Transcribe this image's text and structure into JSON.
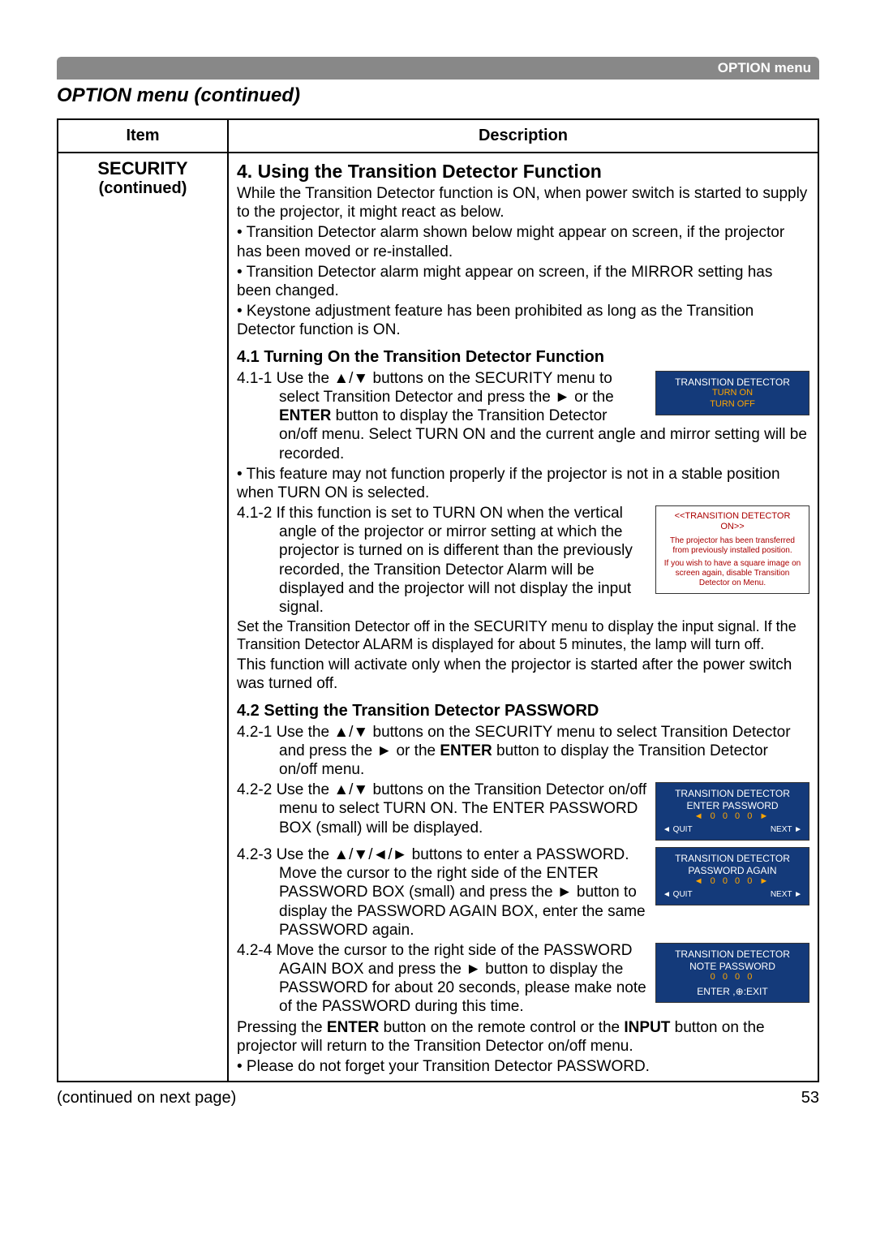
{
  "topbar": "OPTION menu",
  "section_title": "OPTION menu (continued)",
  "table": {
    "header_item": "Item",
    "header_desc": "Description",
    "item_label": "SECURITY",
    "item_sub": "(continued)"
  },
  "desc": {
    "h3": "4. Using the Transition Detector Function",
    "p1": "While the Transition Detector function is ON, when power switch is started to supply to the projector, it might react as below.",
    "b1": "• Transition Detector alarm shown below might appear on screen, if the projector has been moved or re-installed.",
    "b2": "• Transition Detector alarm might appear on screen, if the MIRROR setting has been changed.",
    "b3": "• Keystone adjustment feature has been prohibited as long as the Transition Detector function is ON.",
    "h4a": "4.1 Turning On the Transition Detector Function",
    "s411a": "4.1-1 Use the ▲/▼ buttons on the SECURITY menu to select Transition Detector and press the ► or the ",
    "s411b": "ENTER",
    "s411c": " button to display the Transition Detector on/off menu. Select TURN ON and the current angle and mirror setting will be recorded.",
    "s411note": "• This feature may not function properly if the projector is not in a stable position when TURN ON is selected.",
    "s412": "4.1-2 If this function is set to TURN ON when the vertical angle of the projector or mirror setting at which the projector is turned on is different than the previously recorded, the Transition Detector Alarm will be displayed and the projector will not display the input signal.",
    "p2": "Set the Transition Detector off in the SECURITY menu to display the input signal. If the Transition Detector ALARM is displayed for about 5 minutes, the lamp will turn off.",
    "p3": "This function will activate only when the projector is started after the power switch was turned off.",
    "h4b": "4.2 Setting the Transition Detector PASSWORD",
    "s421a": "4.2-1 Use the ▲/▼ buttons on the SECURITY menu to select Transition Detector and press the ► or the ",
    "s421b": "ENTER",
    "s421c": " button to display the Transition Detector on/off menu.",
    "s422": "4.2-2 Use the ▲/▼ buttons on the Transition Detector on/off menu to select TURN ON. The ENTER PASSWORD BOX (small) will be displayed.",
    "s423": "4.2-3 Use the ▲/▼/◄/► buttons to enter a PASSWORD. Move the cursor to the right side of the ENTER PASSWORD BOX (small) and press the ► button to display the PASSWORD AGAIN BOX, enter the same PASSWORD again.",
    "s424": "4.2-4 Move the cursor to the right side of the PASSWORD AGAIN BOX and press the ► button to display the PASSWORD for about 20 seconds, please make note of the PASSWORD during this time.",
    "p4a": "Pressing the ",
    "p4b": "ENTER",
    "p4c": " button on the remote control or the ",
    "p4d": "INPUT",
    "p4e": " button on the projector will return to the Transition Detector on/off menu.",
    "b4": "• Please do not forget your Transition Detector PASSWORD."
  },
  "box1": {
    "title": "TRANSITION DETECTOR",
    "on": "TURN ON",
    "off": "TURN OFF"
  },
  "box2": {
    "title": "<<TRANSITION DETECTOR ON>>",
    "line1": "The projector has been transferred from previously installed position.",
    "line2": "If you wish to have a square image on screen again, disable Transition Detector on Menu."
  },
  "box3": {
    "title": "TRANSITION DETECTOR",
    "sub": "ENTER PASSWORD",
    "digits": "◄ 0 0 0 0 ►",
    "quit": "◄ QUIT",
    "next": "NEXT ►"
  },
  "box4": {
    "title": "TRANSITION DETECTOR",
    "sub": "PASSWORD AGAIN",
    "digits": "◄ 0 0 0 0 ►",
    "quit": "◄ QUIT",
    "next": "NEXT ►"
  },
  "box5": {
    "title": "TRANSITION DETECTOR",
    "sub": "NOTE PASSWORD",
    "digits": "0 0 0 0",
    "exit": "ENTER ,⊕:EXIT"
  },
  "bottom_left": "(continued on next page)",
  "page_num": "53"
}
